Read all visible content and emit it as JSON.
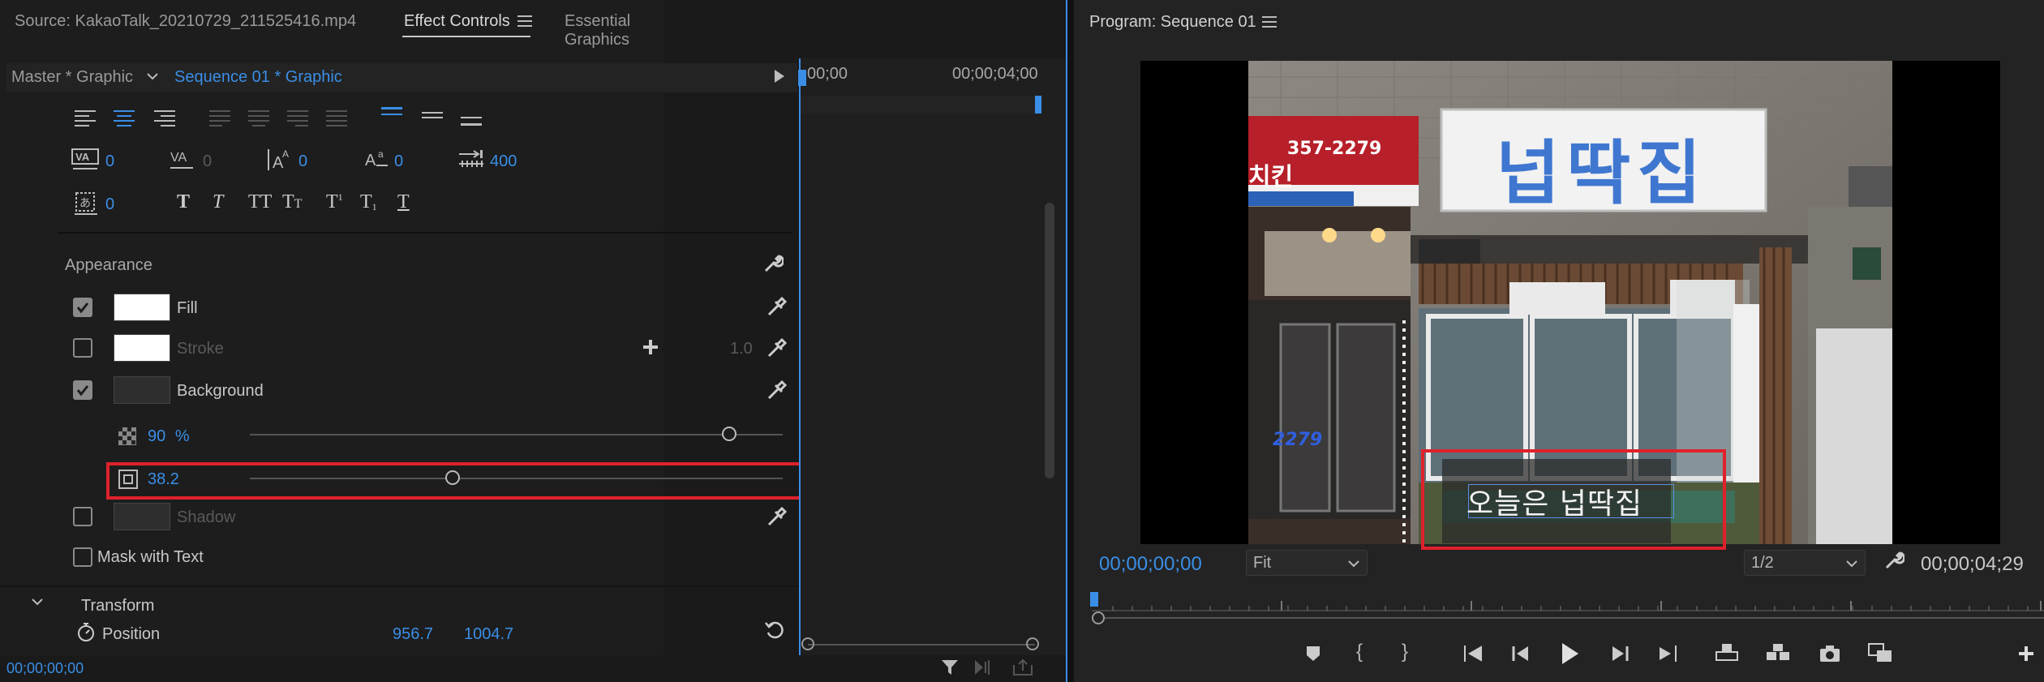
{
  "left_tabs": {
    "source": "Source: KakaoTalk_20210729_211525416.mp4",
    "effect_controls": "Effect Controls",
    "essential_graphics": "Essential Graphics"
  },
  "breadcrumb": {
    "master": "Master * Graphic",
    "sequence": "Sequence 01 * Graphic"
  },
  "timeline_ruler": {
    "start": "00;00",
    "end": "00;00;04;00"
  },
  "text_props": {
    "kerning": "0",
    "tracking": "0",
    "leading": "0",
    "baseline": "0",
    "tab_width": "400",
    "tsume": "0"
  },
  "appearance": {
    "title": "Appearance",
    "fill_label": "Fill",
    "stroke_label": "Stroke",
    "stroke_width": "1.0",
    "background_label": "Background",
    "opacity_value": "90",
    "opacity_unit": "%",
    "size_value": "38.2",
    "shadow_label": "Shadow",
    "mask_label": "Mask with Text",
    "opacity_level": 0.9,
    "size_level": 0.38
  },
  "transform": {
    "title": "Transform",
    "position_label": "Position",
    "position_x": "956.7",
    "position_y": "1004.7"
  },
  "left_timecode": "00;00;00;00",
  "program": {
    "title": "Program: Sequence 01",
    "timecode": "00;00;00;00",
    "zoom": "Fit",
    "resolution": "1/2",
    "duration": "00;00;04;29"
  },
  "video": {
    "sign_text": "넙딱집",
    "phone_left": "357-2279",
    "phone_small": "2279",
    "chicken": "치킨",
    "caption": "오늘은 넙딱집"
  },
  "colors": {
    "accent_blue": "#3a8ee6",
    "highlight_red": "#e0212b"
  }
}
